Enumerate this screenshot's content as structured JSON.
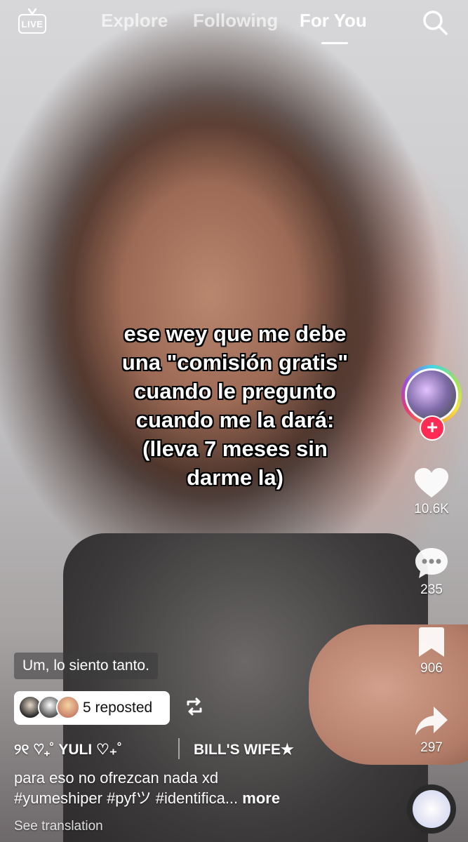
{
  "nav": {
    "live_label": "LIVE",
    "tabs": [
      {
        "label": "Explore"
      },
      {
        "label": "Following"
      },
      {
        "label": "For You"
      }
    ]
  },
  "video": {
    "caption_lines": [
      "ese wey que me debe",
      "una \"comisión gratis\"",
      "cuando le pregunto",
      "cuando me la dará:",
      "(lleva 7 meses sin",
      "darme la)"
    ],
    "lyric": "Um, lo siento tanto."
  },
  "actions": {
    "likes": "10.6K",
    "comments": "235",
    "saves": "906",
    "shares": "297"
  },
  "repost": {
    "label": "5 reposted"
  },
  "author": {
    "username": "୨୧ ♡₊˚ YULI ♡₊˚",
    "subtitle": "BILL'S WIFE★"
  },
  "description": {
    "text": "para eso no ofrezcan nada xd",
    "hashtags": "#yumeshiper #pyfツ #identifica...",
    "more": "more"
  },
  "see_translation": "See translation",
  "colors": {
    "follow_button": "#fe2c55",
    "text": "#ffffff"
  }
}
